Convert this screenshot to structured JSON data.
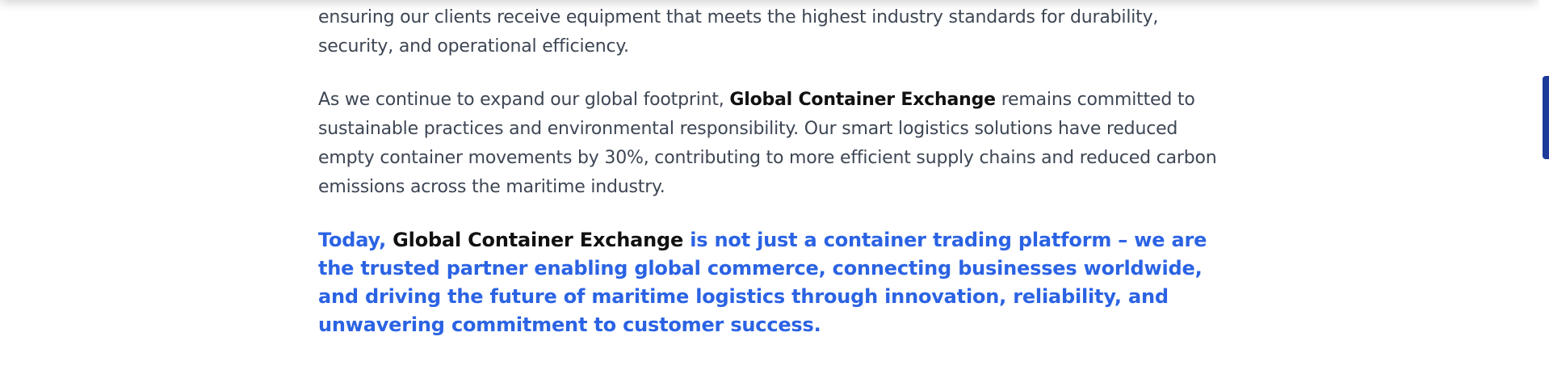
{
  "article": {
    "para1": "ensuring our clients receive equipment that meets the highest industry standards for durability, security, and operational efficiency.",
    "para2": {
      "before": "As we continue to expand our global footprint, ",
      "brand": "Global Container Exchange",
      "after": " remains committed to sustainable practices and environmental responsibility. Our smart logistics solutions have reduced empty container movements by 30%, contributing to more efficient supply chains and reduced carbon emissions across the maritime industry."
    },
    "highlight": {
      "before": "Today, ",
      "brand": "Global Container Exchange",
      "after": " is not just a container trading platform – we are the trusted partner enabling global commerce, connecting businesses worldwide, and driving the future of maritime logistics through innovation, reliability, and unwavering commitment to customer success."
    }
  },
  "scroll": {
    "position_fraction": 0.21
  },
  "colors": {
    "accent": "#2b63e3",
    "body_text": "#3d4654",
    "heading_text": "#111111",
    "scrollbar": "#1c3a9a"
  }
}
